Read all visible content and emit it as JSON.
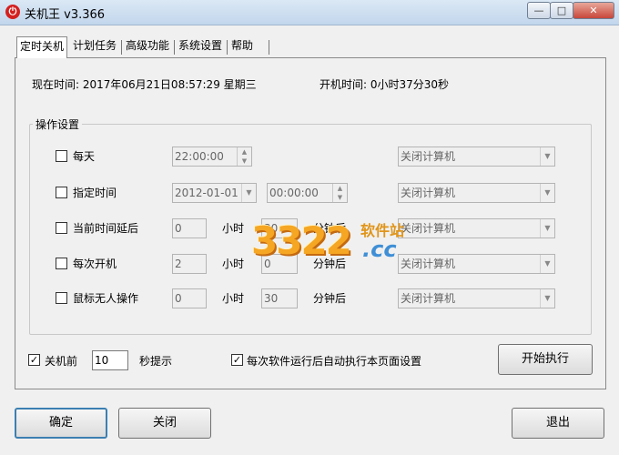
{
  "window": {
    "title": "关机王 v3.366",
    "app_icon": "power-icon",
    "controls": {
      "min": "—",
      "max": "□",
      "close": "✕"
    }
  },
  "tabs": [
    {
      "label": "定时关机",
      "active": true
    },
    {
      "label": "计划任务"
    },
    {
      "label": "高级功能"
    },
    {
      "label": "系统设置"
    },
    {
      "label": "帮助"
    }
  ],
  "status": {
    "current_time": "现在时间: 2017年06月21日08:57:29 星期三",
    "boot_time": "开机时间: 0小时37分30秒"
  },
  "group_title": "操作设置",
  "options": {
    "daily": {
      "label": "每天",
      "checked": false,
      "time": "22:00:00",
      "action": "关闭计算机"
    },
    "specific_time": {
      "label": "指定时间",
      "checked": false,
      "date": "2012-01-01",
      "time": "00:00:00",
      "action": "关闭计算机"
    },
    "delay": {
      "label": "当前时间延后",
      "checked": false,
      "hours": "0",
      "hours_unit": "小时",
      "minutes": "30",
      "minutes_unit": "分钟后",
      "action": "关闭计算机"
    },
    "each_boot": {
      "label": "每次开机",
      "checked": false,
      "hours": "2",
      "hours_unit": "小时",
      "minutes": "0",
      "minutes_unit": "分钟后",
      "action": "关闭计算机"
    },
    "idle": {
      "label": "鼠标无人操作",
      "checked": false,
      "hours": "0",
      "hours_unit": "小时",
      "minutes": "30",
      "minutes_unit": "分钟后",
      "action": "关闭计算机"
    }
  },
  "bottom": {
    "prompt_checked_mark": "✓",
    "prompt_label": "关机前",
    "prompt_seconds": "10",
    "prompt_suffix": "秒提示",
    "auto_run_checked_mark": "✓",
    "auto_run_label": "每次软件运行后自动执行本页面设置",
    "start_button": "开始执行"
  },
  "footer": {
    "ok": "确定",
    "close": "关闭",
    "exit": "退出"
  },
  "watermark": {
    "digits": "3322",
    "site_cn": "软件站",
    "domain": ".cc"
  }
}
